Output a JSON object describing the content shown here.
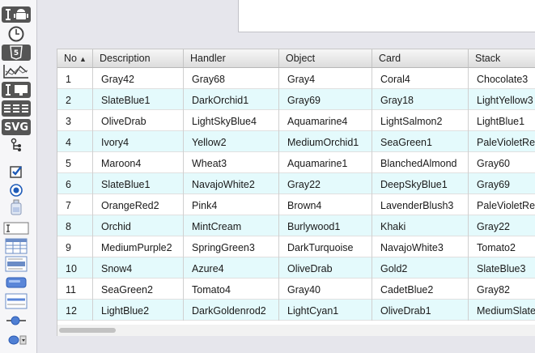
{
  "toolbar": {
    "tools": [
      {
        "icon": "text-android-icon"
      },
      {
        "icon": "clock-icon"
      },
      {
        "icon": "html5-icon",
        "label": "5"
      },
      {
        "icon": "line-chart-icon"
      },
      {
        "icon": "text-monitor-icon"
      },
      {
        "icon": "columns-icon"
      },
      {
        "icon": "svg-icon",
        "label": "SVG"
      },
      {
        "icon": "tree-icon"
      },
      {
        "icon": "checkbox-icon"
      },
      {
        "icon": "radio-icon"
      },
      {
        "icon": "bottle-icon"
      },
      {
        "icon": "text-field-icon"
      },
      {
        "icon": "table-icon"
      },
      {
        "icon": "list-icon"
      },
      {
        "icon": "button-icon"
      },
      {
        "icon": "slider-panel-icon"
      },
      {
        "icon": "slider-icon"
      },
      {
        "icon": "combo-icon"
      }
    ]
  },
  "grid": {
    "columns": [
      "No",
      "Description",
      "Handler",
      "Object",
      "Card",
      "Stack"
    ],
    "sorted_column": "No",
    "sort_indicator": "▲",
    "rows": [
      [
        "1",
        "Gray42",
        "Gray68",
        "Gray4",
        "Coral4",
        "Chocolate3"
      ],
      [
        "2",
        "SlateBlue1",
        "DarkOrchid1",
        "Gray69",
        "Gray18",
        "LightYellow3"
      ],
      [
        "3",
        "OliveDrab",
        "LightSkyBlue4",
        "Aquamarine4",
        "LightSalmon2",
        "LightBlue1"
      ],
      [
        "4",
        "Ivory4",
        "Yellow2",
        "MediumOrchid1",
        "SeaGreen1",
        "PaleVioletRed"
      ],
      [
        "5",
        "Maroon4",
        "Wheat3",
        "Aquamarine1",
        "BlanchedAlmond",
        "Gray60"
      ],
      [
        "6",
        "SlateBlue1",
        "NavajoWhite2",
        "Gray22",
        "DeepSkyBlue1",
        "Gray69"
      ],
      [
        "7",
        "OrangeRed2",
        "Pink4",
        "Brown4",
        "LavenderBlush3",
        "PaleVioletRed"
      ],
      [
        "8",
        "Orchid",
        "MintCream",
        "Burlywood1",
        "Khaki",
        "Gray22"
      ],
      [
        "9",
        "MediumPurple2",
        "SpringGreen3",
        "DarkTurquoise",
        "NavajoWhite3",
        "Tomato2"
      ],
      [
        "10",
        "Snow4",
        "Azure4",
        "OliveDrab",
        "Gold2",
        "SlateBlue3"
      ],
      [
        "11",
        "SeaGreen2",
        "Tomato4",
        "Gray40",
        "CadetBlue2",
        "Gray82"
      ],
      [
        "12",
        "LightBlue2",
        "DarkGoldenrod2",
        "LightCyan1",
        "OliveDrab1",
        "MediumSlateB"
      ]
    ],
    "colors": {
      "alt_row": "#e4fafc",
      "row": "#ffffff"
    }
  }
}
